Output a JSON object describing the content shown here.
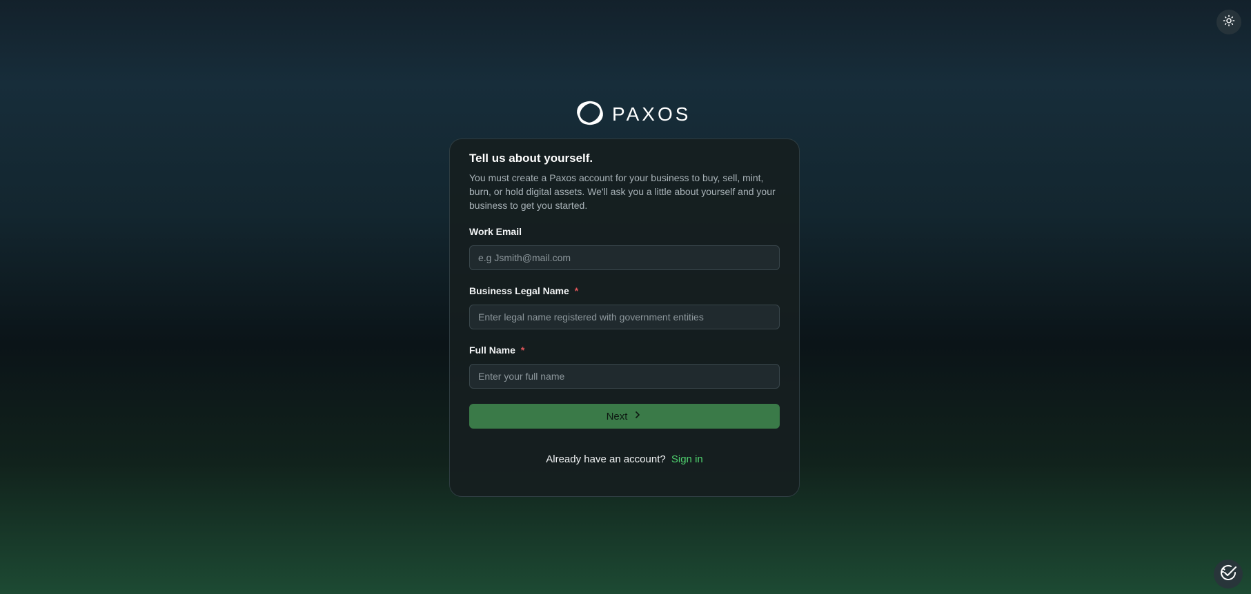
{
  "header": {
    "theme_toggle_icon": "sun-icon"
  },
  "brand": {
    "logo_icon": "paxos-logo-icon",
    "name": "PAXOS"
  },
  "form": {
    "title": "Tell us about yourself.",
    "description": "You must create a Paxos account for your business to buy, sell, mint, burn, or hold digital assets. We'll ask you a little about yourself and your business to get you started.",
    "fields": [
      {
        "label": "Work Email",
        "required": false,
        "placeholder": "e.g Jsmith@mail.com",
        "value": ""
      },
      {
        "label": "Business Legal Name",
        "required": true,
        "placeholder": "Enter legal name registered with government entities",
        "value": ""
      },
      {
        "label": "Full Name",
        "required": true,
        "placeholder": "Enter your full name",
        "value": ""
      }
    ],
    "required_marker": "*",
    "next_label": "Next",
    "next_icon": "chevron-right-icon",
    "signin_prompt": "Already have an account?",
    "signin_link": "Sign in"
  },
  "widget": {
    "icon": "checklist-help-icon"
  },
  "colors": {
    "accent": "#3a7a48",
    "link": "#4fd16e",
    "required": "#e0565a"
  }
}
